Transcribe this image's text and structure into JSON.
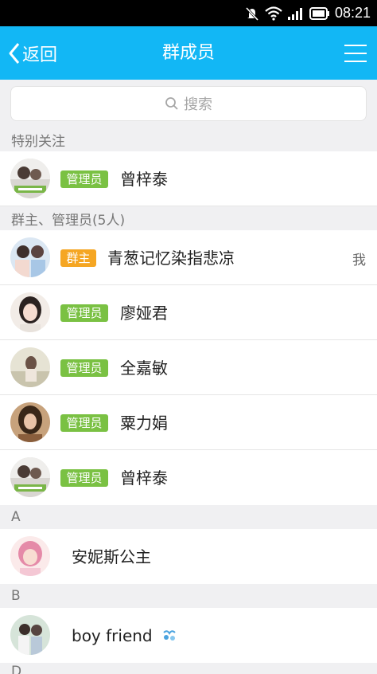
{
  "status_bar": {
    "time": "08:21"
  },
  "nav": {
    "back_label": "返回",
    "title": "群成员"
  },
  "search": {
    "placeholder": "搜索"
  },
  "sections": {
    "special": "特别关注",
    "admins": "群主、管理员(5人)",
    "a": "A",
    "b": "B",
    "d": "D"
  },
  "special_members": [
    {
      "badge": "管理员",
      "name": "曾梓泰"
    }
  ],
  "admin_members": [
    {
      "badge": "群主",
      "name": "青葱记忆染指悲凉",
      "me": "我"
    },
    {
      "badge": "管理员",
      "name": "廖娅君"
    },
    {
      "badge": "管理员",
      "name": "全嘉敏"
    },
    {
      "badge": "管理员",
      "name": "粟力娟"
    },
    {
      "badge": "管理员",
      "name": "曾梓泰"
    }
  ],
  "a_members": [
    {
      "name": "安妮斯公主"
    }
  ],
  "b_members": [
    {
      "name": "boy  friend"
    }
  ],
  "colors": {
    "nav_bg": "#12b7f5",
    "admin_badge": "#7ac143",
    "owner_badge": "#f5a623"
  }
}
